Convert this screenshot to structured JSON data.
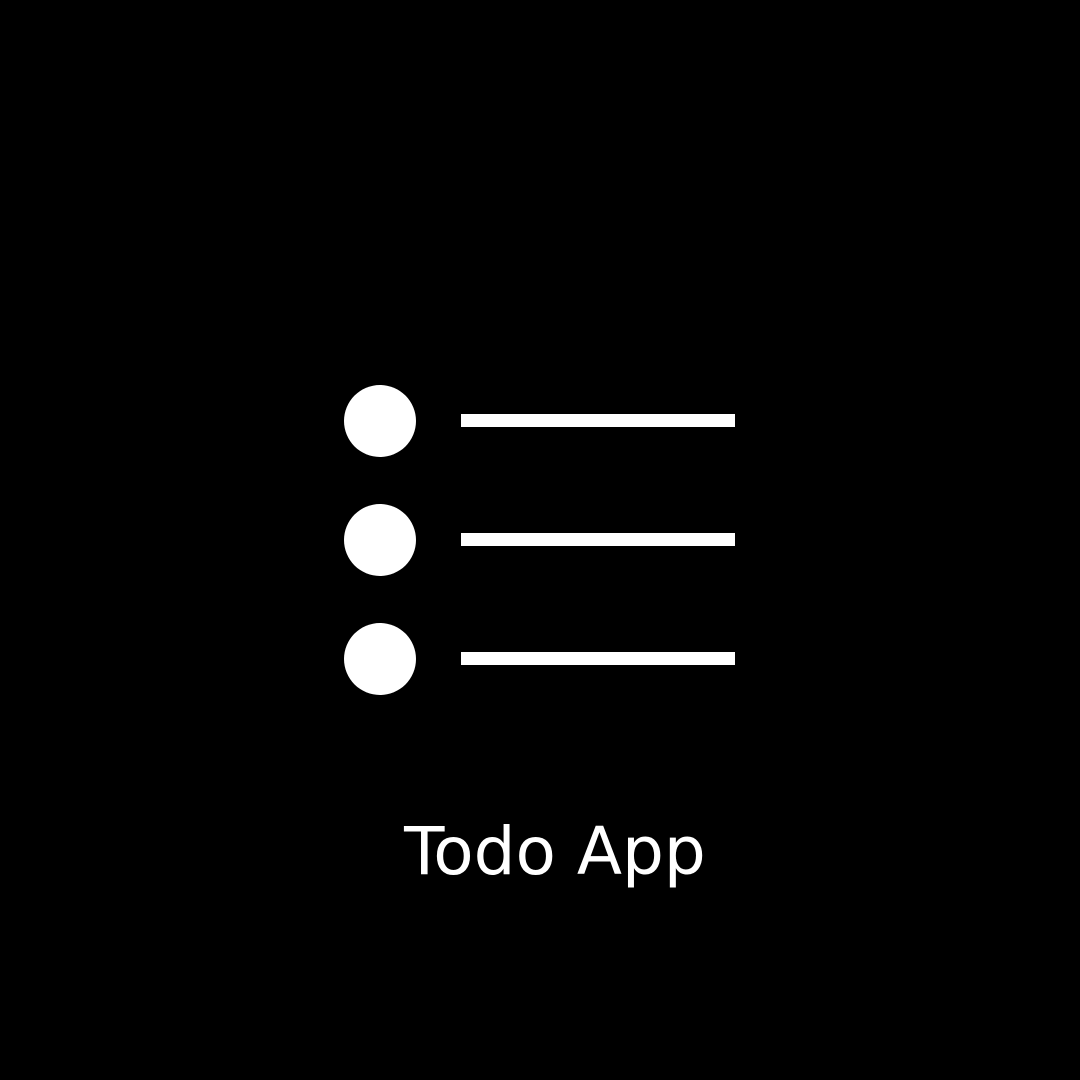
{
  "app": {
    "title": "Todo App",
    "icon": "list-bullets-icon"
  },
  "colors": {
    "background": "#000000",
    "foreground": "#ffffff"
  }
}
